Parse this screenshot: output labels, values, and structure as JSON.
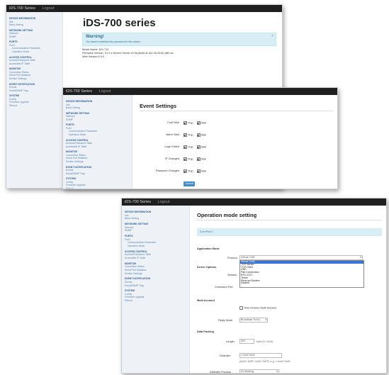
{
  "topbar": {
    "brand": "iDS-700 Series",
    "logout": "Logout"
  },
  "sidebar": {
    "sections": [
      {
        "head": "DEVICE INFORMATION",
        "items": [
          {
            "label": "Info",
            "sub": false
          },
          {
            "label": "Basic Setting",
            "sub": false
          }
        ]
      },
      {
        "head": "NETWORK SETTING",
        "items": [
          {
            "label": "Network",
            "sub": false
          },
          {
            "label": "SNMP",
            "sub": false
          }
        ]
      },
      {
        "head": "PORTS",
        "items": [
          {
            "label": "Port1",
            "sub": false
          },
          {
            "label": "Communication Parameter",
            "sub": true
          },
          {
            "label": "Operation Mode",
            "sub": true
          }
        ]
      },
      {
        "head": "ACCESS CONTROL",
        "items": [
          {
            "label": "Account/Password Table",
            "sub": false
          },
          {
            "label": "Accessible IP Table",
            "sub": false
          }
        ]
      },
      {
        "head": "MONITOR",
        "items": [
          {
            "label": "Connection Status",
            "sub": false
          },
          {
            "label": "Serial Port Statistics",
            "sub": false
          },
          {
            "label": "Monitor Settings",
            "sub": false
          }
        ]
      },
      {
        "head": "EVENT NOTIFICATION",
        "items": [
          {
            "label": "Events",
            "sub": false
          },
          {
            "label": "Email/SNMP Trap",
            "sub": false
          }
        ]
      },
      {
        "head": "SYSTEM",
        "items": [
          {
            "label": "Config",
            "sub": false
          },
          {
            "label": "Firmware upgrade",
            "sub": false
          },
          {
            "label": "Reboot",
            "sub": false
          }
        ]
      }
    ]
  },
  "window1": {
    "title": "iDS-700 series",
    "warning_title": "Warning!",
    "warning_text": "You haven't set/initial the password for this device.",
    "info_lines": [
      "Model Name: iDS-714",
      "Firmware Version: V1.0.4 Device Server v0.3a (build at Jan 26 2015) with ac",
      "Web Version:0.9.0"
    ]
  },
  "window2": {
    "title": "Event Settings",
    "rows": [
      {
        "label": "Cold Start",
        "trap": "Trap",
        "mail": "Mail"
      },
      {
        "label": "Warm Start",
        "trap": "Trap",
        "mail": "Mail"
      },
      {
        "label": "Login Failed",
        "trap": "Trap",
        "mail": "Mail"
      },
      {
        "label": "IP Changed",
        "trap": "Trap",
        "mail": "Mail"
      },
      {
        "label": "Password Changed",
        "trap": "Trap",
        "mail": "Mail"
      }
    ],
    "submit": "Submit"
  },
  "window3": {
    "title": "Operation mode setting",
    "port_pill": "Com Port 1",
    "application_mode": "Application Mode",
    "protocol_label": "Protocol",
    "protocol_value": "Virtual COM",
    "protocol_options": [
      "Virtual COM",
      "TCP Server",
      "TCP Client",
      "UDP",
      "Pair Connection",
      "RFC 2217",
      "Telnet",
      "Ethernet Modem",
      "Disable"
    ],
    "server_options": "Server Options",
    "session_label": "Session",
    "command_port_label": "Command Port",
    "multi_account": "Multi Account",
    "time_division": "Time Division Multi Session",
    "reply_label": "Reply Mode",
    "reply_value": "Broadcast To ALL",
    "data_packing": "Data Packing",
    "length_label": "Length",
    "length_value": "500",
    "length_hint": "byte (0~1024)",
    "delimiter_label": "Delimiter",
    "delimiter_value": "1 0x00 0x00",
    "delimiter_hint": "(0x00~0xFF, 0x00~0xFF) e.g. 1 0x00 0x00",
    "process_label": "Delimiter Process",
    "process_value": "Do Nothing"
  }
}
